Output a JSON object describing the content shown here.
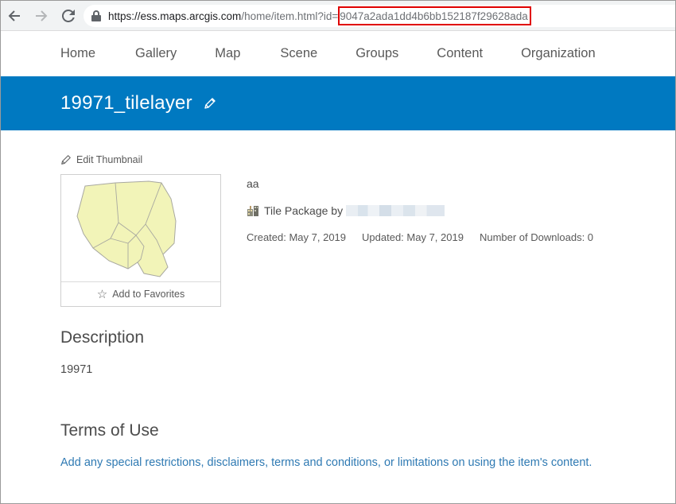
{
  "browser": {
    "url_host": "https://ess.maps.arcgis.com",
    "url_path": "/home/item.html?id=",
    "url_id": "9047a2ada1dd4b6bb152187f29628ada"
  },
  "nav": {
    "items": [
      "Home",
      "Gallery",
      "Map",
      "Scene",
      "Groups",
      "Content",
      "Organization"
    ]
  },
  "item": {
    "title": "19971_tilelayer",
    "edit_thumbnail_label": "Edit Thumbnail",
    "add_favorites_label": "Add to Favorites",
    "summary": "aa",
    "type_label": "Tile Package by",
    "created": "Created: May 7, 2019",
    "updated": "Updated: May 7, 2019",
    "downloads": "Number of Downloads: 0"
  },
  "description": {
    "heading": "Description",
    "body": "19971"
  },
  "terms": {
    "heading": "Terms of Use",
    "link_text": "Add any special restrictions, disclaimers, terms and conditions, or limitations on using the item's content."
  },
  "colors": {
    "brand_blue": "#0079c1",
    "link_blue": "#2f7ab3",
    "highlight_red": "#e00000",
    "map_fill": "#f2f4b8"
  },
  "icons": [
    "back-arrow-icon",
    "forward-arrow-icon",
    "reload-icon",
    "lock-icon",
    "pencil-icon",
    "star-icon",
    "tile-package-icon"
  ]
}
